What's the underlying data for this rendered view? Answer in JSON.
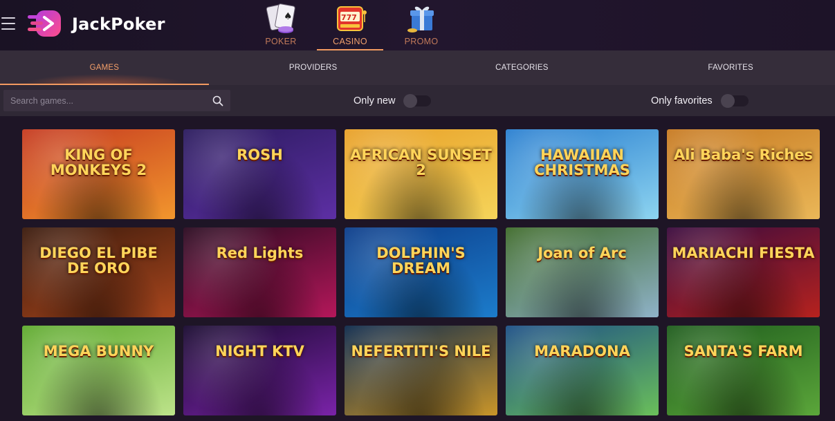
{
  "brand": {
    "name": "JackPoker",
    "accent": "#f39a60"
  },
  "header": {
    "menu_icon": "hamburger-icon",
    "products": [
      {
        "label": "POKER",
        "icon": "playing-cards-icon",
        "active": false
      },
      {
        "label": "CASINO",
        "icon": "slot-machine-icon",
        "active": true
      },
      {
        "label": "PROMO",
        "icon": "gift-box-icon",
        "active": false
      }
    ]
  },
  "tabs": [
    {
      "label": "GAMES",
      "active": true
    },
    {
      "label": "PROVIDERS",
      "active": false
    },
    {
      "label": "CATEGORIES",
      "active": false
    },
    {
      "label": "FAVORITES",
      "active": false
    }
  ],
  "filters": {
    "search_placeholder": "Search games...",
    "search_value": "",
    "only_new": {
      "label": "Only new",
      "on": false
    },
    "only_favorites": {
      "label": "Only favorites",
      "on": false
    }
  },
  "games": [
    {
      "title": "KING OF MONKEYS 2",
      "colors": [
        "#c53a20",
        "#f2962d"
      ]
    },
    {
      "title": "ROSH",
      "colors": [
        "#2b1b5e",
        "#5d2fa4"
      ]
    },
    {
      "title": "AFRICAN SUNSET 2",
      "colors": [
        "#e8a028",
        "#f5d45a"
      ]
    },
    {
      "title": "HAWAIIAN CHRISTMAS",
      "colors": [
        "#2a7fd0",
        "#8dd4f0"
      ]
    },
    {
      "title": "Ali Baba's Riches",
      "colors": [
        "#c77a22",
        "#eab758"
      ]
    },
    {
      "title": "DIEGO EL PIBE DE ORO",
      "colors": [
        "#3a1a0c",
        "#a9461d"
      ]
    },
    {
      "title": "Red Lights",
      "colors": [
        "#2a0a20",
        "#b4175a"
      ]
    },
    {
      "title": "DOLPHIN'S DREAM",
      "colors": [
        "#0c3d8a",
        "#1c7ccb"
      ]
    },
    {
      "title": "Joan of Arc",
      "colors": [
        "#3f6b2b",
        "#8fb2c8"
      ]
    },
    {
      "title": "MARIACHI FIESTA",
      "colors": [
        "#3b0b3e",
        "#b6221e"
      ]
    },
    {
      "title": "MEGA BUNNY",
      "colors": [
        "#5ea92e",
        "#bde38a"
      ]
    },
    {
      "title": "NIGHT KTV",
      "colors": [
        "#190a30",
        "#7a23a8"
      ]
    },
    {
      "title": "NEFERTITI'S NILE",
      "colors": [
        "#0e2a4c",
        "#c99529"
      ]
    },
    {
      "title": "MARADONA",
      "colors": [
        "#1d4f86",
        "#6abf5a"
      ]
    },
    {
      "title": "SANTA'S FARM",
      "colors": [
        "#1f5c1d",
        "#5ba63a"
      ]
    }
  ]
}
